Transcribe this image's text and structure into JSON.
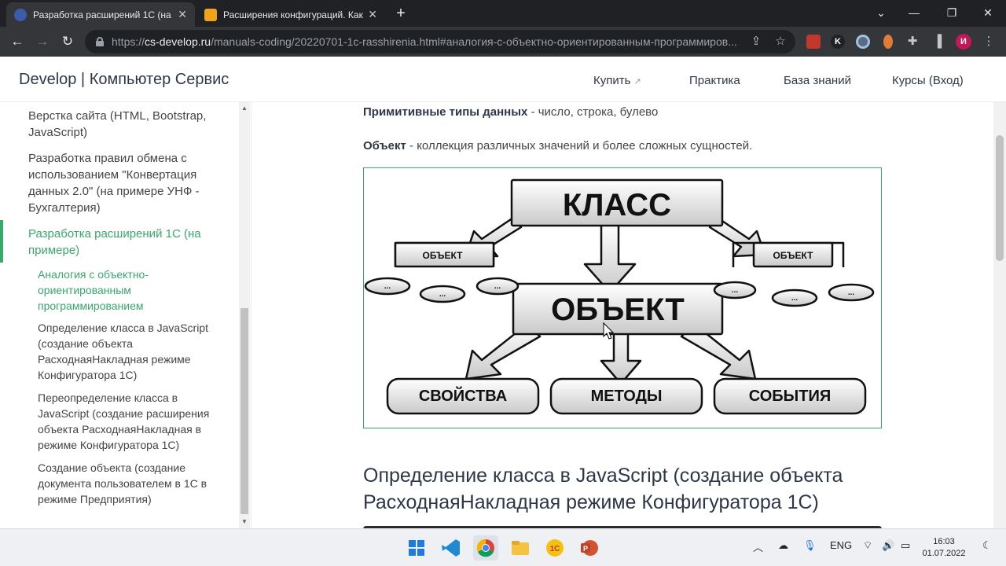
{
  "browser": {
    "tabs": [
      {
        "title": "Разработка расширений 1С (на",
        "close": "✕"
      },
      {
        "title": "Расширения конфигураций. Как",
        "close": "✕"
      }
    ],
    "url_host": "cs-develop.ru",
    "url_rest": "/manuals-coding/20220701-1c-rasshirenia.html#аналогия-с-объектно-ориентированным-программиров...",
    "url_scheme": "https://",
    "profile_initial": "И",
    "ext_k": "K"
  },
  "site": {
    "brand": "Develop | Компьютер Сервис",
    "nav": [
      {
        "label": "Купить",
        "external": "↗"
      },
      {
        "label": "Практика"
      },
      {
        "label": "База знаний"
      },
      {
        "label": "Курсы (Вход)"
      }
    ]
  },
  "sidebar": {
    "items": [
      "Верстка сайта (HTML, Bootstrap, JavaScript)",
      "Разработка правил обмена с использованием \"Конвертация данных 2.0\" (на примере УНФ - Бухгалтерия)",
      "Разработка расширений 1С (на примере)"
    ],
    "subitems": [
      "Аналогия с объектно-ориентированным программированием",
      "Определение класса в JavaScript (создание объекта РасходнаяНакладная режиме Конфигуратора 1С)",
      "Переопределение класса в JavaScript (создание расширения объекта РасходнаяНакладная в режиме Конфигуратора 1С)",
      "Создание объекта (создание документа пользователем в 1С в режиме Предприятия)"
    ]
  },
  "content": {
    "p1_bold": "Примитивные типы данных",
    "p1_rest": " - число, строка, булево",
    "p2_bold": "Объект",
    "p2_rest": " - коллекция различных значений и более сложных сущностей.",
    "diagram": {
      "class": "КЛАСС",
      "object": "ОБЪЕКТ",
      "object_small": "ОБЪЕКТ",
      "dots": "...",
      "props": "СВОЙСТВА",
      "methods": "МЕТОДЫ",
      "events": "СОБЫТИЯ"
    },
    "heading": "Определение класса в JavaScript (создание объекта РасходнаяНакладная режиме Конфигуратора 1С)"
  },
  "taskbar": {
    "lang": "ENG",
    "time": "16:03",
    "date": "01.07.2022"
  },
  "colors": {
    "accent": "#3aa76d",
    "chrome_dark": "#202124",
    "chrome_tab": "#35363a"
  }
}
